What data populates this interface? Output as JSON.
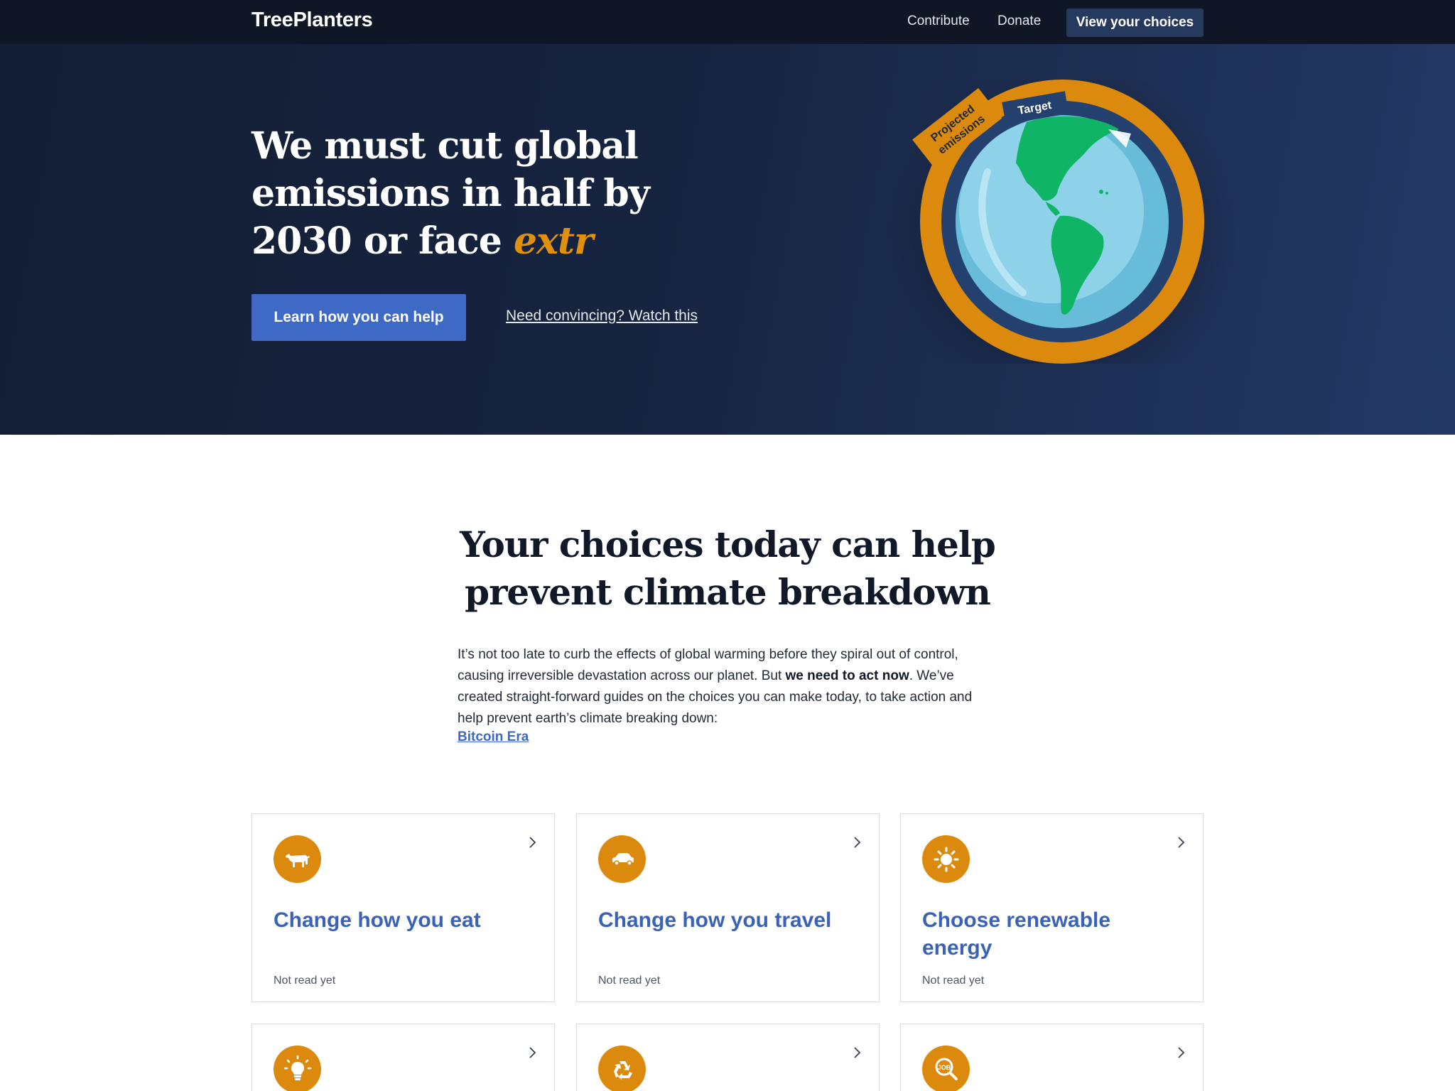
{
  "nav": {
    "brand": "TreePlanters",
    "links": [
      "Contribute",
      "Donate"
    ],
    "cta": "View your choices"
  },
  "hero": {
    "title_main": "We must cut global emissions in half by 2030 or face ",
    "title_accent": "extr",
    "cta": "Learn how you can help",
    "video_link": "Need convincing? Watch this",
    "diagram": {
      "outer_label": "Projected emissions",
      "inner_label": "Target",
      "colors": {
        "outer_ring": "#dc8a0e",
        "inner_ring": "#24406e",
        "ocean": "#89cfe6",
        "land": "#0fb565"
      }
    }
  },
  "intro": {
    "title": "Your choices today can help prevent climate breakdown",
    "paragraph_before": "It’s not too late to curb the effects of global warming before they spiral out of control, causing irreversible devastation across our planet. But ",
    "paragraph_bold": "we need to act now",
    "paragraph_after": ". We’ve created straight-forward guides on the choices you can make today, to take action and help prevent earth’s climate breaking down:",
    "link": "Bitcoin Era"
  },
  "cards": [
    {
      "icon": "cow-icon",
      "title": "Change how you eat",
      "status": "Not read yet"
    },
    {
      "icon": "car-icon",
      "title": "Change how you travel",
      "status": "Not read yet"
    },
    {
      "icon": "sun-icon",
      "title": "Choose renewable energy",
      "status": "Not read yet"
    },
    {
      "icon": "lightbulb-icon"
    },
    {
      "icon": "recycle-icon"
    },
    {
      "icon": "job-search-icon"
    }
  ],
  "colors": {
    "accent_orange": "#dc8a0e",
    "link_blue": "#3e6ac6",
    "nav_bg": "#0f1626",
    "hero_bg": "#172440"
  }
}
